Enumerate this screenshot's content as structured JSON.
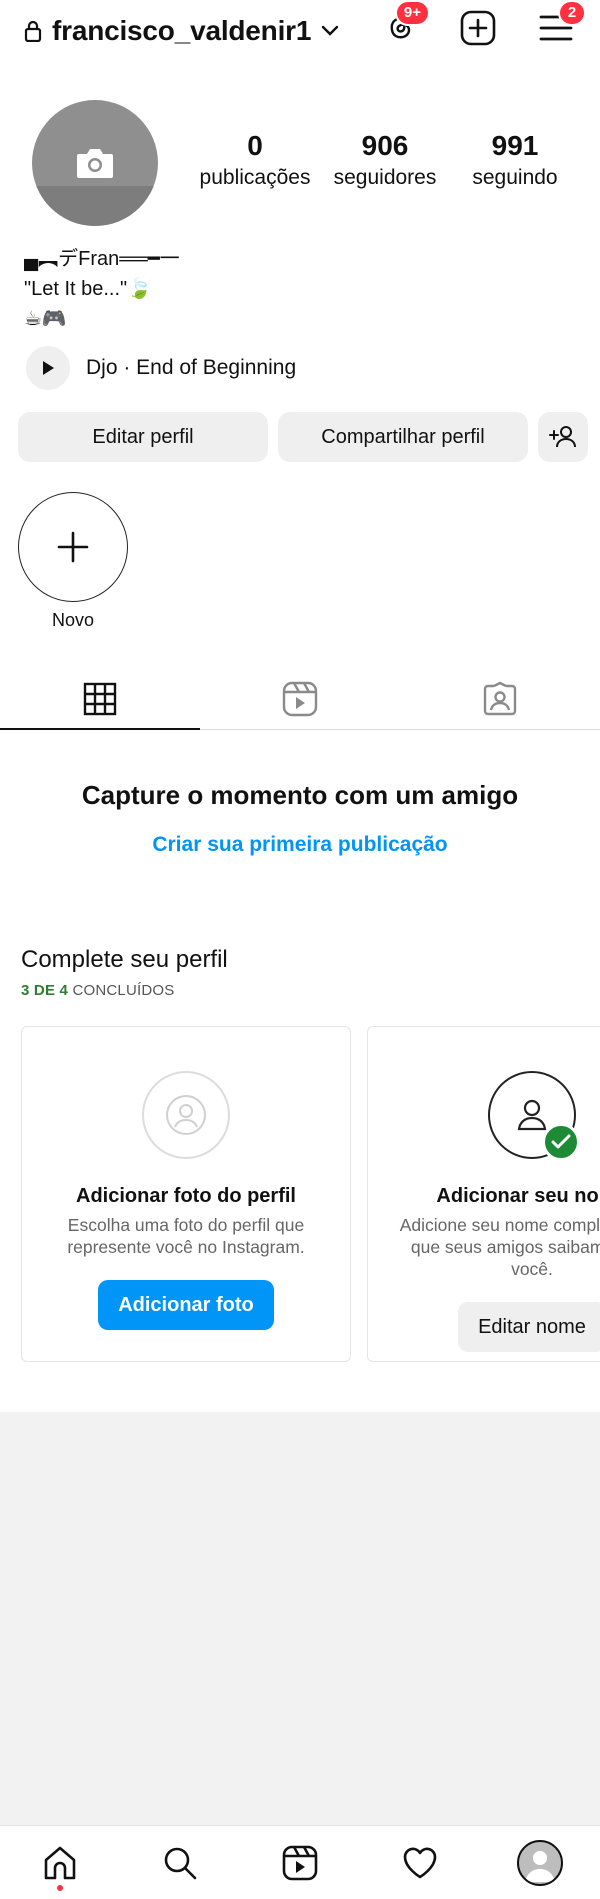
{
  "header": {
    "username": "francisco_valdenir1",
    "threads_badge": "9+",
    "menu_badge": "2"
  },
  "profile": {
    "stats": [
      {
        "value": "0",
        "label": "publicações"
      },
      {
        "value": "906",
        "label": "seguidores"
      },
      {
        "value": "991",
        "label": "seguindo"
      }
    ],
    "bio_lines": [
      "▄︻デFran══━一",
      "\"Let It be...\"🍃",
      "☕🎮"
    ],
    "music": "Djo · End of Beginning"
  },
  "buttons": {
    "edit": "Editar perfil",
    "share": "Compartilhar perfil"
  },
  "story": {
    "new_label": "Novo"
  },
  "empty_state": {
    "title": "Capture o momento com um amigo",
    "link": "Criar sua primeira publicação"
  },
  "complete": {
    "title": "Complete seu perfil",
    "progress_count": "3 DE 4",
    "progress_text": "CONCLUÍDOS",
    "cards": [
      {
        "title": "Adicionar foto do perfil",
        "desc": "Escolha uma foto do perfil que represente você no Instagram.",
        "button": "Adicionar foto"
      },
      {
        "title": "Adicionar seu nome",
        "desc": "Adicione seu nome completo para que seus amigos saibam que é você.",
        "button": "Editar nome"
      }
    ]
  },
  "colors": {
    "accent": "#0095f6",
    "badge": "#ff3040",
    "success": "#1d8a35"
  }
}
